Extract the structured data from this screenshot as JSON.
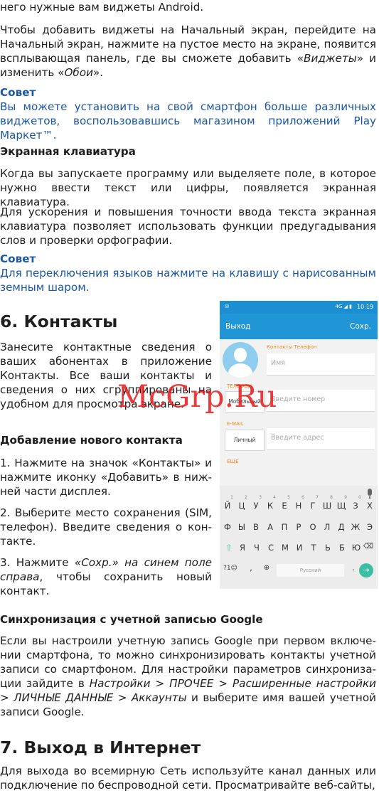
{
  "p1": "него нужные вам виджеты Android.",
  "p2": {
    "a": "Чтобы добавить виджеты на Начальный экран, перейдите на Начальный экран, нажмите на пустое место на экране, появит­ся всплывающая панель, где вы сможете добавить «",
    "em1": "Виджеты",
    "b": "» и изменить «",
    "em2": "Обои",
    "c": "»."
  },
  "tip1": {
    "heading": "Совет",
    "text": "Вы можете установить на свой смартфон больше различных вид­жетов, воспользовавшись магазином приложений Play Маркет™."
  },
  "kb_section": {
    "heading": "Экранная клавиатура",
    "p1": "Когда вы запускаете программу или выделяете поле, в которое нужно ввести текст или цифры, появляется экранная клавиатура.",
    "p2": "Для ускорения и повышения точности ввода текста экранная кла­виатура позволяет использовать функции предугадывания слов и проверки орфографии."
  },
  "tip2": {
    "heading": "Совет",
    "text": "Для переключения языков нажмите на клавишу  с нарисованным земным шаром."
  },
  "contacts": {
    "title": "6. Контакты",
    "intro": "Занесите контактные сведения о ва­ших абонентах в приложение Кон­такты. Все ваши контакты и сведения о них сгруппированы на удобном для просмотра экране.",
    "add_heading": "Добавление нового контакта",
    "step1": "1. Нажмите на значок «Контакты» и нажмите иконку «Добавить» в ниж­ней части дисплея.",
    "step2": "2. Выберите место сохранения (SIM, телефон). Введите сведения о кон­такте.",
    "step3_a": "3. Нажмите ",
    "step3_em": "«Сохр.» на синем поле справа",
    "step3_b": ", чтобы сохранить новый контакт."
  },
  "sync": {
    "heading": "Синхронизация с учетной записью Google",
    "a": "Если вы настроили учетную запись Google при первом включе­нии смартфона, то можно синхронизировать контакты учетной записи со смартфоном. Для настройки параметров синхрониза­ции зайдите в ",
    "path": "Настройки > ПРОЧЕЕ > Расширенные настройки > ЛИЧНЫЕ ДАННЫЕ > Аккаунты",
    "b": " и выберите имя вашей учетной записи Google."
  },
  "internet": {
    "title": "7. Выход в Интернет",
    "text": "Для выхода во всемирную Сеть используйте канал данных или подключение по беспроводной сети. Просматривайте веб-сайты,"
  },
  "phone": {
    "status_time": "10:19",
    "status_signal": "4G",
    "back_label": "Выход",
    "save_label": "Сохр.",
    "account_label": "Контакты Телефон",
    "name_placeholder": "Имя",
    "phone_section": "ТЕЛЕФОН",
    "phone_type": "Мобильный",
    "phone_placeholder": "Введите номер",
    "email_section": "E-MAIL",
    "email_type": "Личный",
    "email_placeholder": "Введите адрес",
    "more_label": "ЕЩЕ",
    "keyboard": {
      "row1": [
        "Й",
        "Ц",
        "У",
        "К",
        "Е",
        "Н",
        "Г",
        "Ш",
        "Щ",
        "З",
        "Х"
      ],
      "row1_hints": [
        "1",
        "2",
        "3",
        "4",
        "5",
        "6",
        "7",
        "8",
        "9",
        "0",
        ""
      ],
      "row2": [
        "Ф",
        "Ы",
        "В",
        "А",
        "П",
        "Р",
        "О",
        "Л",
        "Д",
        "Ж",
        "Э"
      ],
      "row3": [
        "Я",
        "Ч",
        "С",
        "М",
        "И",
        "Т",
        "Ь",
        "Б",
        "Ю"
      ],
      "symbols_key": "?1☺",
      "comma_key": ",",
      "space_label": "Русский",
      "period_key": "."
    }
  },
  "watermark": "McGrp.Ru"
}
